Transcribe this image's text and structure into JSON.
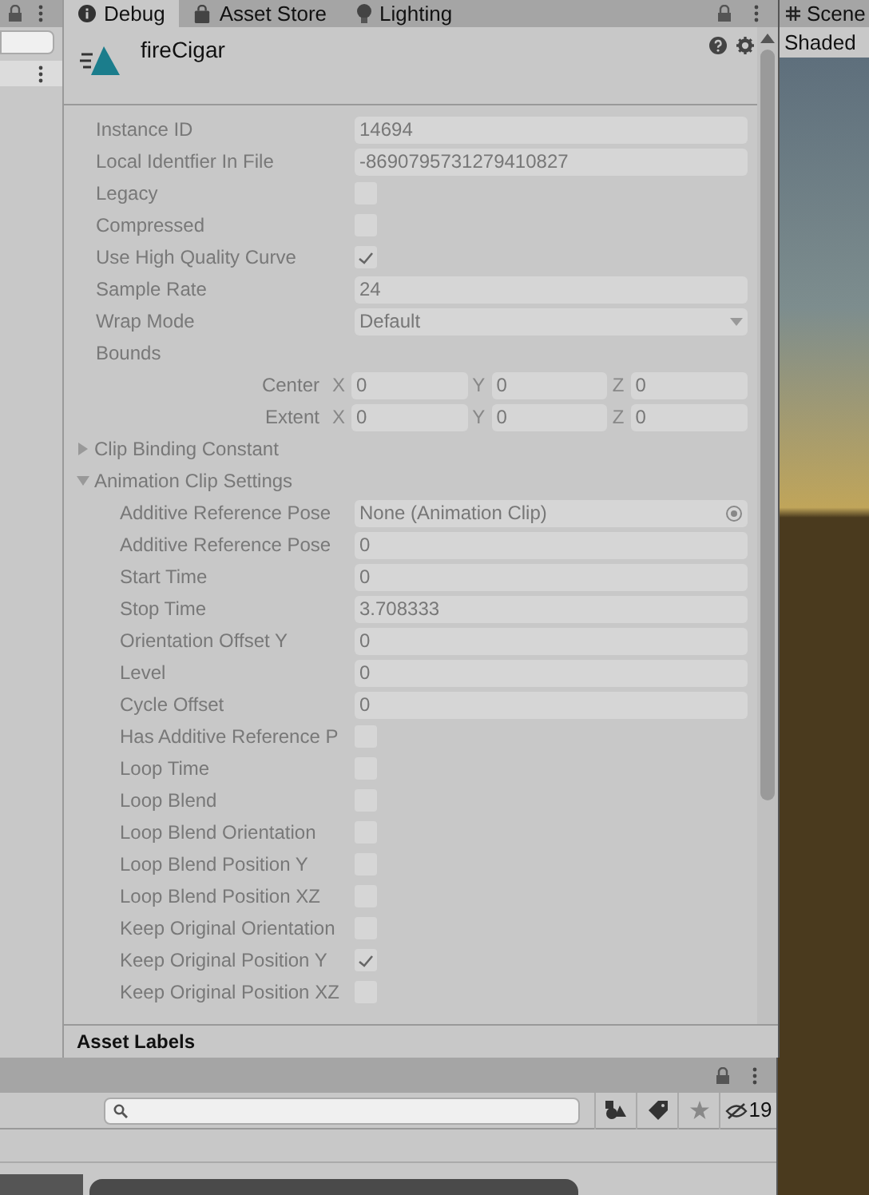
{
  "tabs": [
    {
      "label": "Debug",
      "selected": true
    },
    {
      "label": "Asset Store",
      "selected": false
    },
    {
      "label": "Lighting",
      "selected": false
    }
  ],
  "header": {
    "title": "fireCigar"
  },
  "rows": [
    {
      "kind": "text",
      "label": "Instance ID",
      "value": "14694"
    },
    {
      "kind": "text",
      "label": "Local Identfier In File",
      "value": "-8690795731279410827"
    },
    {
      "kind": "checkbox",
      "label": "Legacy",
      "checked": false
    },
    {
      "kind": "checkbox",
      "label": "Compressed",
      "checked": false
    },
    {
      "kind": "checkbox",
      "label": "Use High Quality Curve",
      "checked": true
    },
    {
      "kind": "text",
      "label": "Sample Rate",
      "value": "24"
    },
    {
      "kind": "dropdown",
      "label": "Wrap Mode",
      "value": "Default"
    },
    {
      "kind": "group",
      "label": "Bounds",
      "children": [
        {
          "kind": "vector",
          "label": "Center",
          "components": [
            {
              "axis": "X",
              "value": "0"
            },
            {
              "axis": "Y",
              "value": "0"
            },
            {
              "axis": "Z",
              "value": "0"
            }
          ]
        },
        {
          "kind": "vector",
          "label": "Extent",
          "components": [
            {
              "axis": "X",
              "value": "0"
            },
            {
              "axis": "Y",
              "value": "0"
            },
            {
              "axis": "Z",
              "value": "0"
            }
          ]
        }
      ]
    },
    {
      "kind": "foldout",
      "label": "Clip Binding Constant",
      "expanded": false
    },
    {
      "kind": "foldout",
      "label": "Animation Clip Settings",
      "expanded": true,
      "children": [
        {
          "kind": "object",
          "label": "Additive Reference Pose",
          "value": "None (Animation Clip)"
        },
        {
          "kind": "text",
          "label": "Additive Reference Pose",
          "value": "0"
        },
        {
          "kind": "text",
          "label": "Start Time",
          "value": "0"
        },
        {
          "kind": "text",
          "label": "Stop Time",
          "value": "3.708333"
        },
        {
          "kind": "text",
          "label": "Orientation Offset Y",
          "value": "0"
        },
        {
          "kind": "text",
          "label": "Level",
          "value": "0"
        },
        {
          "kind": "text",
          "label": "Cycle Offset",
          "value": "0"
        },
        {
          "kind": "checkbox",
          "label": "Has Additive Reference P",
          "checked": false
        },
        {
          "kind": "checkbox",
          "label": "Loop Time",
          "checked": false
        },
        {
          "kind": "checkbox",
          "label": "Loop Blend",
          "checked": false
        },
        {
          "kind": "checkbox",
          "label": "Loop Blend Orientation",
          "checked": false
        },
        {
          "kind": "checkbox",
          "label": "Loop Blend Position Y",
          "checked": false
        },
        {
          "kind": "checkbox",
          "label": "Loop Blend Position XZ",
          "checked": false
        },
        {
          "kind": "checkbox",
          "label": "Keep Original Orientation",
          "checked": false
        },
        {
          "kind": "checkbox",
          "label": "Keep Original Position Y",
          "checked": true
        },
        {
          "kind": "checkbox",
          "label": "Keep Original Position XZ",
          "checked": false
        }
      ]
    }
  ],
  "asset_labels": "Asset Labels",
  "scene": {
    "tab": "Scene",
    "mode": "Shaded"
  },
  "project": {
    "hidden_count": "19"
  }
}
